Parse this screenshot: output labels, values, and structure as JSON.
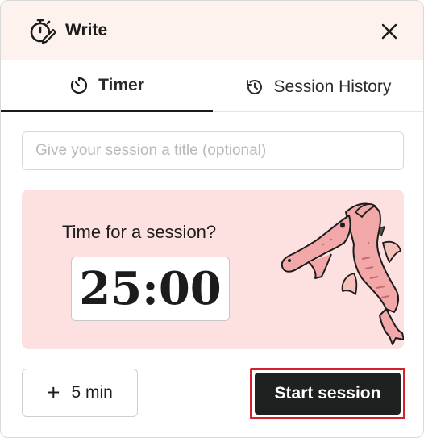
{
  "header": {
    "title": "Write",
    "icon": "stopwatch-pencil-icon",
    "close_icon": "close-icon"
  },
  "tabs": [
    {
      "label": "Timer",
      "icon": "timer-icon",
      "active": true
    },
    {
      "label": "Session History",
      "icon": "history-icon",
      "active": false
    }
  ],
  "session": {
    "title_value": "",
    "title_placeholder": "Give your session a title (optional)"
  },
  "card": {
    "prompt": "Time for a session?",
    "timer": "25:00",
    "illustration": "dragon-illustration"
  },
  "actions": {
    "add_time_label": "5 min",
    "add_time_icon": "plus-icon",
    "start_label": "Start session"
  },
  "colors": {
    "header_bg": "#fdf2ee",
    "card_bg": "#fde1e0",
    "start_bg": "#1e2120",
    "highlight": "#d8202a"
  }
}
